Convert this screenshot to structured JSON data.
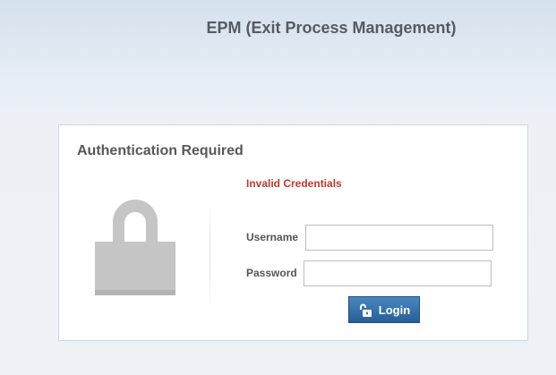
{
  "app": {
    "title": "EPM (Exit Process Management)"
  },
  "auth_panel": {
    "title": "Authentication Required",
    "error_message": "Invalid Credentials",
    "lock_icon": "lock-icon"
  },
  "form": {
    "username_label": "Username",
    "username_value": "",
    "password_label": "Password",
    "password_value": "",
    "login_label": "Login",
    "login_icon": "unlock-icon"
  },
  "colors": {
    "error": "#c0392b",
    "button": "#2f6aa3",
    "panel_border": "#c9d8e6"
  }
}
